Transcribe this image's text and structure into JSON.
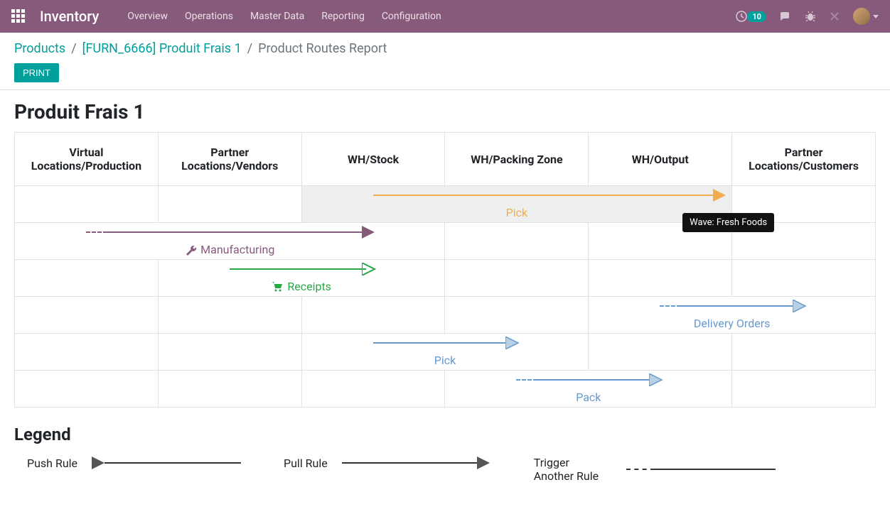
{
  "topbar": {
    "app_title": "Inventory",
    "menu": [
      "Overview",
      "Operations",
      "Master Data",
      "Reporting",
      "Configuration"
    ],
    "activity_count": "10"
  },
  "breadcrumb": {
    "items": [
      {
        "label": "Products",
        "link": true
      },
      {
        "label": "[FURN_6666] Produit Frais 1",
        "link": true
      },
      {
        "label": "Product Routes Report",
        "link": false
      }
    ]
  },
  "buttons": {
    "print": "PRINT"
  },
  "page_title": "Produit Frais 1",
  "columns": [
    "Virtual Locations/Production",
    "Partner Locations/Vendors",
    "WH/Stock",
    "WH/Packing Zone",
    "WH/Output",
    "Partner Locations/Customers"
  ],
  "rules": [
    {
      "label": "Pick",
      "color": "#f0ad4e",
      "highlighted": true
    },
    {
      "label": "Manufacturing",
      "color": "#875a7b",
      "icon": "wrench"
    },
    {
      "label": "Receipts",
      "color": "#28a745",
      "icon": "cart"
    },
    {
      "label": "Delivery Orders",
      "color": "#6699cc"
    },
    {
      "label": "Pick",
      "color": "#6699cc"
    },
    {
      "label": "Pack",
      "color": "#6699cc"
    }
  ],
  "tooltip": "Wave: Fresh Foods",
  "legend": {
    "title": "Legend",
    "items": [
      "Push Rule",
      "Pull Rule",
      "Trigger Another Rule"
    ]
  }
}
